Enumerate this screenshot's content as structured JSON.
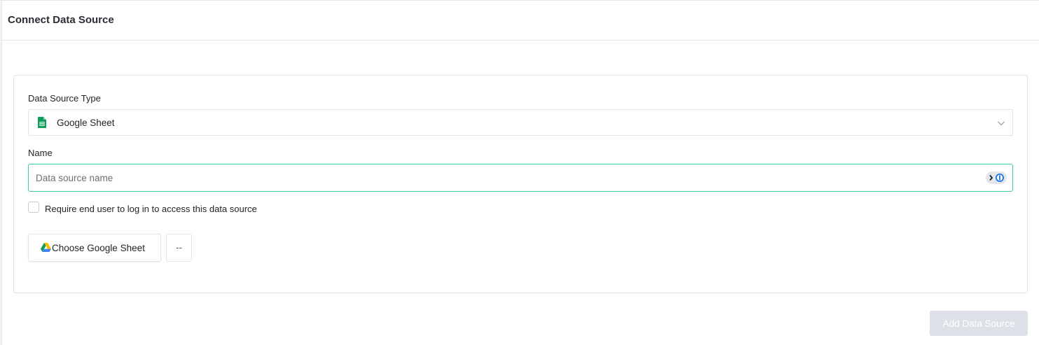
{
  "header": {
    "title": "Connect Data Source"
  },
  "form": {
    "source_type_label": "Data Source Type",
    "source_type_value": "Google Sheet",
    "source_type_icon": "google-sheets-icon",
    "name_label": "Name",
    "name_placeholder": "Data source name",
    "name_value": "",
    "require_login_label": "Require end user to log in to access this data source",
    "require_login_checked": false,
    "choose_sheet_label": "Choose Google Sheet",
    "choose_sheet_icon": "google-drive-icon",
    "selected_sheet": "--"
  },
  "footer": {
    "add_button_label": "Add Data Source",
    "add_button_disabled": true
  },
  "colors": {
    "focus_border": "#3ecf9a",
    "sheets_green": "#0f9d58",
    "disabled_button": "#dde1e7"
  }
}
